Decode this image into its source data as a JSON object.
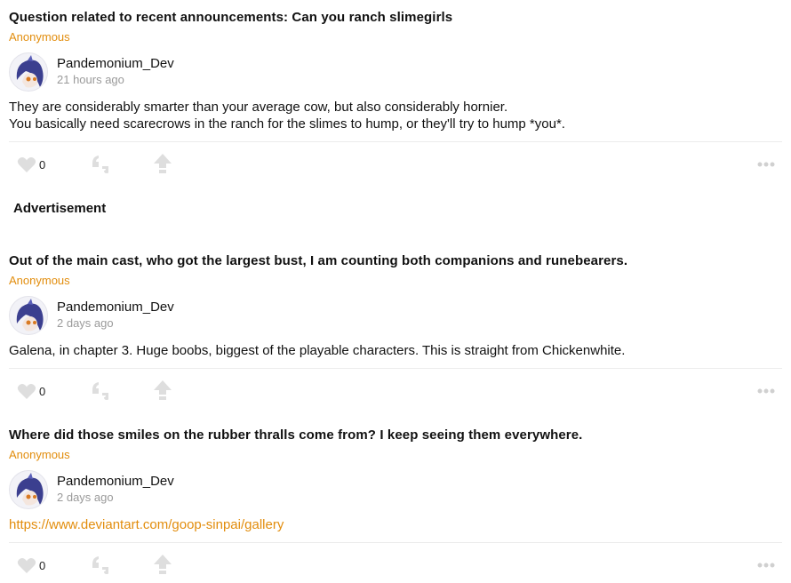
{
  "advertisement_label": "Advertisement",
  "posts": [
    {
      "question": "Question related to recent announcements: Can you ranch slimegirls",
      "asker": "Anonymous",
      "author": "Pandemonium_Dev",
      "time": "21 hours ago",
      "answer_lines": [
        "They are considerably smarter than your average cow, but also considerably hornier.",
        "You basically need scarecrows in the ranch for the slimes to hump, or they'll try to hump *you*."
      ],
      "likes": "0"
    },
    {
      "question": "Out of the main cast, who got the largest bust, I am counting both companions and runebearers.",
      "asker": "Anonymous",
      "author": "Pandemonium_Dev",
      "time": "2 days ago",
      "answer_lines": [
        "Galena, in chapter 3. Huge boobs, biggest of the playable characters. This is straight from Chickenwhite."
      ],
      "likes": "0"
    },
    {
      "question": "Where did those smiles on the rubber thralls come from? I keep seeing them everywhere.",
      "asker": "Anonymous",
      "author": "Pandemonium_Dev",
      "time": "2 days ago",
      "answer_link": "https://www.deviantart.com/goop-sinpai/gallery",
      "likes": "0"
    }
  ],
  "icons": {
    "like": "heart-icon",
    "quote": "quote-icon",
    "share": "share-arrow-icon",
    "more": "more-dots-icon"
  },
  "colors": {
    "accent": "#e28d0d",
    "muted": "#9a9a9a",
    "icon": "#dedede"
  }
}
